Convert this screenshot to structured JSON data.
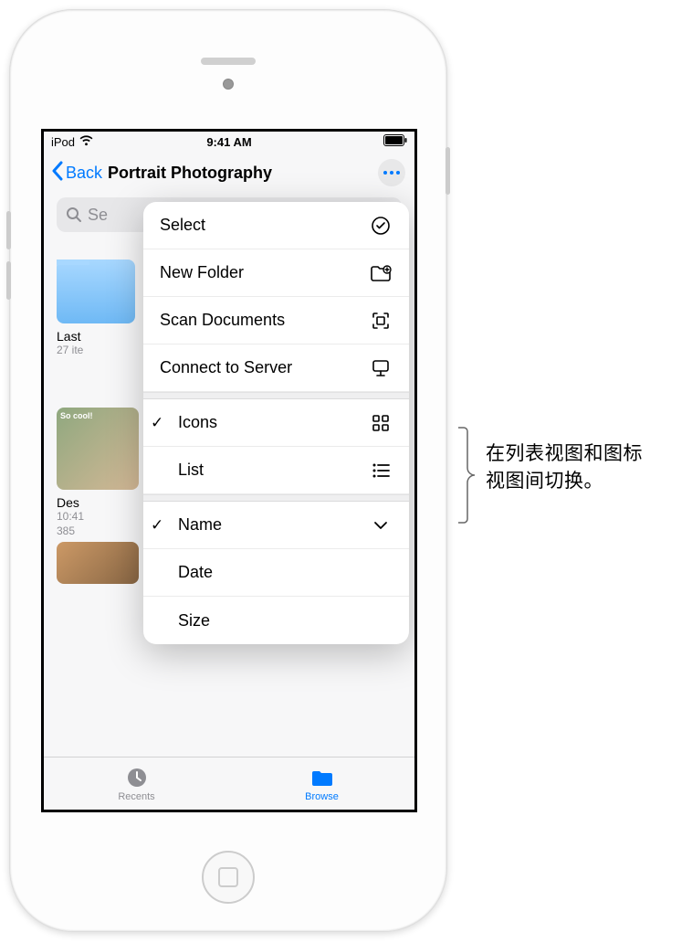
{
  "status_bar": {
    "device": "iPod",
    "time": "9:41 AM"
  },
  "nav": {
    "back_label": "Back",
    "title": "Portrait Photography"
  },
  "search": {
    "placeholder": "Search",
    "visible_text": "Se"
  },
  "folder": {
    "name": "Last",
    "meta": "27 ite"
  },
  "photo1": {
    "title": "Des",
    "time": "10:41",
    "size": "385"
  },
  "popup": {
    "select": "Select",
    "new_folder": "New Folder",
    "scan_documents": "Scan Documents",
    "connect_to_server": "Connect to Server",
    "icons": "Icons",
    "list": "List",
    "name": "Name",
    "date": "Date",
    "size": "Size"
  },
  "tabs": {
    "recents": "Recents",
    "browse": "Browse"
  },
  "annotation": {
    "line1": "在列表视图和图标",
    "line2": "视图间切换。"
  }
}
